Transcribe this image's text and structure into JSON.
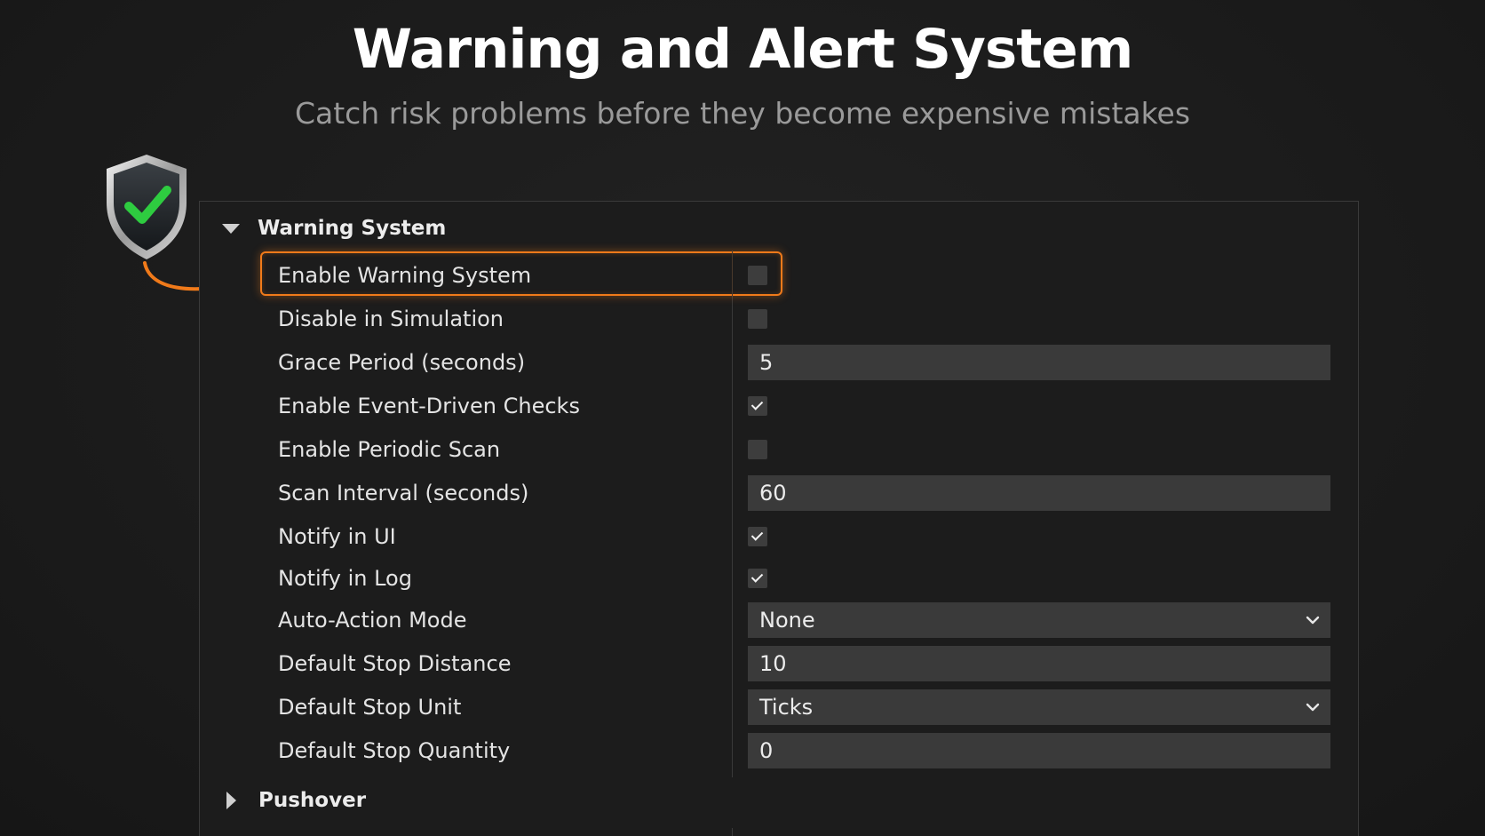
{
  "header": {
    "title": "Warning and Alert System",
    "subtitle": "Catch risk problems before they become expensive mistakes"
  },
  "icons": {
    "shield": "shield-check-icon",
    "arrow": "curved-arrow-icon",
    "expanded": "triangle-down-icon",
    "collapsed": "triangle-right-icon",
    "dropdown": "chevron-down-icon"
  },
  "colors": {
    "accent": "#f07a1a",
    "check_green": "#2ecc40",
    "background": "#1b1b1b",
    "field": "#3a3a3a"
  },
  "sections": {
    "warning_system": {
      "label": "Warning System",
      "expanded": true
    },
    "pushover": {
      "label": "Pushover",
      "expanded": false
    }
  },
  "settings": {
    "enable_warning_system": {
      "label": "Enable Warning System",
      "checked": false
    },
    "disable_in_simulation": {
      "label": "Disable in Simulation",
      "checked": false
    },
    "grace_period": {
      "label": "Grace Period (seconds)",
      "value": "5"
    },
    "enable_event_driven": {
      "label": "Enable Event-Driven Checks",
      "checked": true
    },
    "enable_periodic_scan": {
      "label": "Enable Periodic Scan",
      "checked": false
    },
    "scan_interval": {
      "label": "Scan Interval (seconds)",
      "value": "60"
    },
    "notify_ui": {
      "label": "Notify in UI",
      "checked": true
    },
    "notify_log": {
      "label": "Notify in Log",
      "checked": true
    },
    "auto_action_mode": {
      "label": "Auto-Action Mode",
      "value": "None"
    },
    "default_stop_distance": {
      "label": "Default Stop Distance",
      "value": "10"
    },
    "default_stop_unit": {
      "label": "Default Stop Unit",
      "value": "Ticks"
    },
    "default_stop_quantity": {
      "label": "Default Stop Quantity",
      "value": "0"
    }
  }
}
